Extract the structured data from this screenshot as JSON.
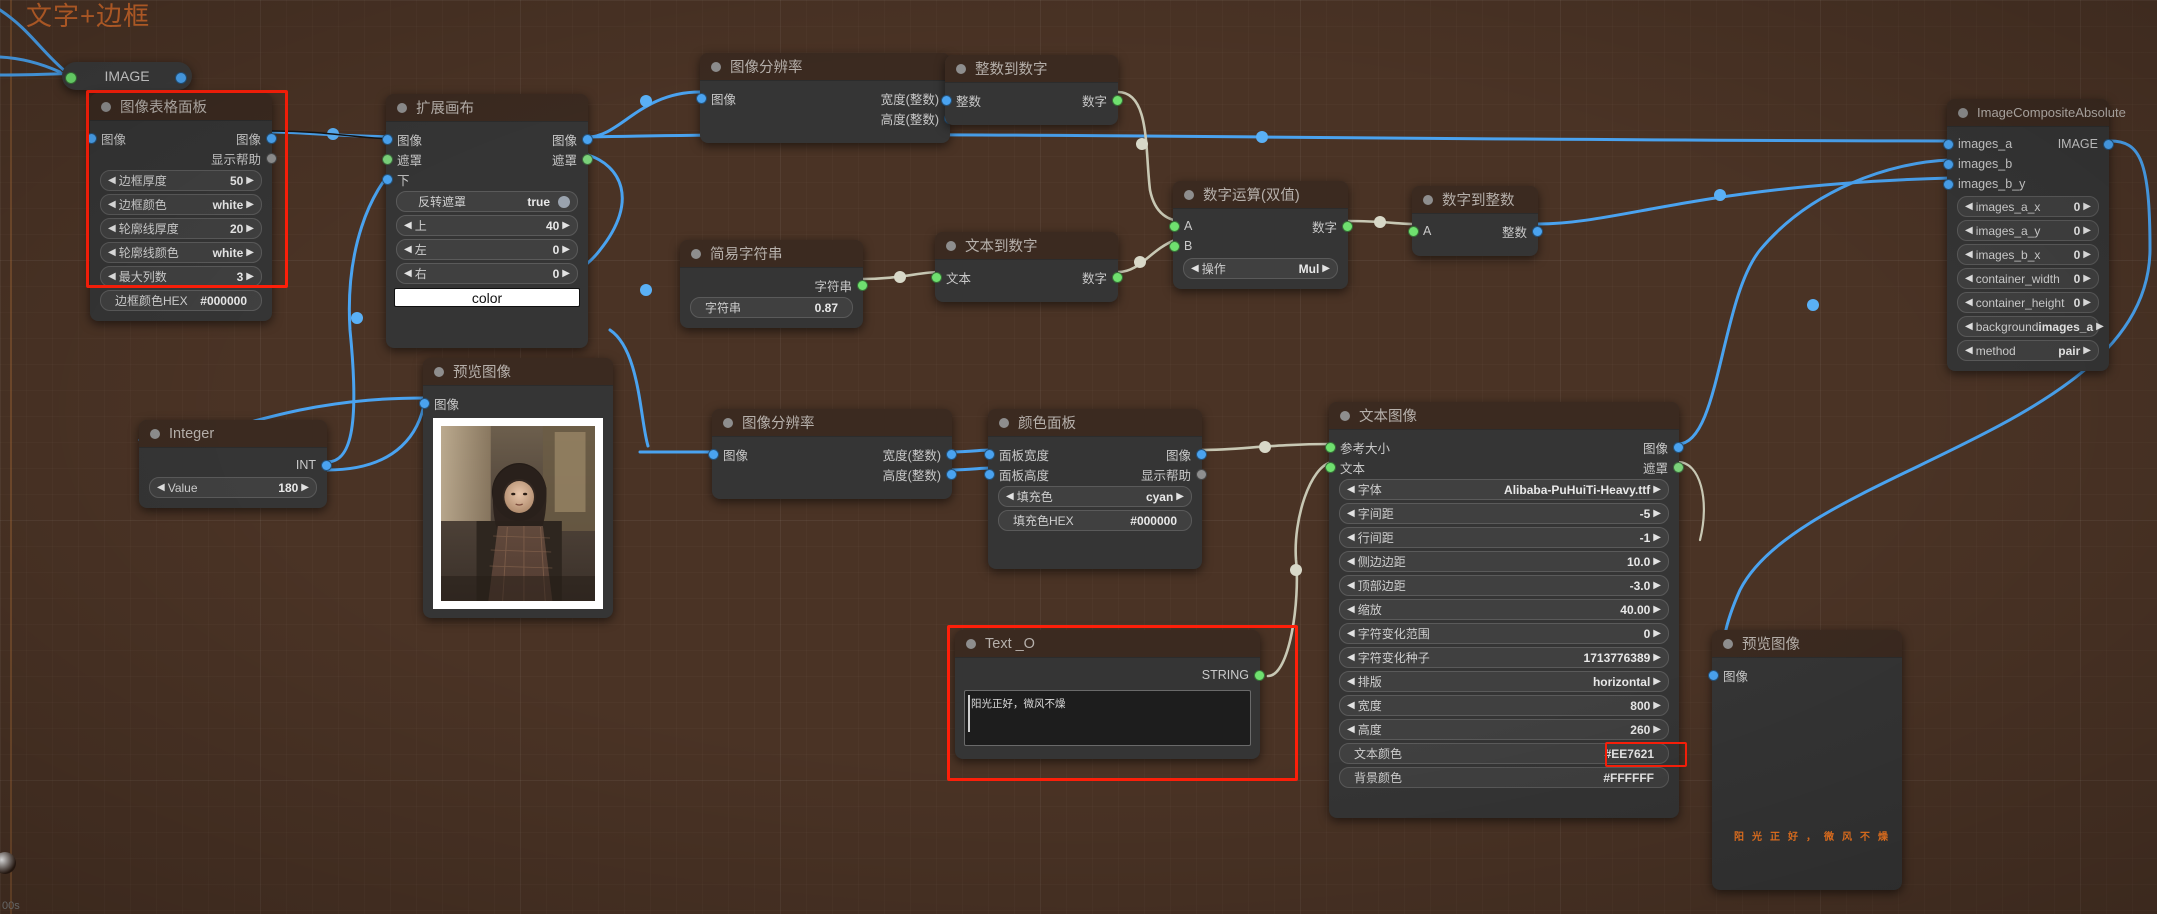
{
  "workspace": {
    "group_title": "文字+边框",
    "status_text": "00s",
    "accent_highlight": "#ff1f09",
    "canvas_bg": "#4a3325",
    "node_bg": "#353535",
    "header_bg": "#3b2a20"
  },
  "reroute": {
    "label": "IMAGE"
  },
  "nodes": {
    "image_grid_panel": {
      "title": "图像表格面板",
      "inputs": [
        {
          "name": "图像",
          "type": "IMAGE"
        }
      ],
      "outputs": [
        {
          "name": "图像",
          "type": "IMAGE"
        },
        {
          "name": "显示帮助",
          "type": "ANY"
        }
      ],
      "widgets": [
        {
          "label": "边框厚度",
          "value": "50"
        },
        {
          "label": "边框颜色",
          "value": "white"
        },
        {
          "label": "轮廓线厚度",
          "value": "20"
        },
        {
          "label": "轮廓线颜色",
          "value": "white"
        },
        {
          "label": "最大列数",
          "value": "3"
        },
        {
          "label": "边框颜色HEX",
          "value": "#000000"
        }
      ]
    },
    "expand_canvas": {
      "title": "扩展画布",
      "inputs": [
        {
          "name": "图像",
          "type": "IMAGE"
        },
        {
          "name": "遮罩",
          "type": "MASK"
        },
        {
          "name": "下",
          "type": "INT"
        }
      ],
      "outputs": [
        {
          "name": "图像",
          "type": "IMAGE"
        },
        {
          "name": "遮罩",
          "type": "MASK"
        }
      ],
      "widgets": [
        {
          "label": "反转遮罩",
          "value": "true",
          "kind": "toggle"
        },
        {
          "label": "上",
          "value": "40"
        },
        {
          "label": "左",
          "value": "0"
        },
        {
          "label": "右",
          "value": "0"
        }
      ],
      "color_bar": "color"
    },
    "image_resolution_top": {
      "title": "图像分辨率",
      "inputs": [
        {
          "name": "图像",
          "type": "IMAGE"
        }
      ],
      "outputs": [
        {
          "name": "宽度(整数)",
          "type": "INT"
        },
        {
          "name": "高度(整数)",
          "type": "INT"
        }
      ]
    },
    "int_to_number": {
      "title": "整数到数字",
      "inputs": [
        {
          "name": "整数",
          "type": "INT"
        }
      ],
      "outputs": [
        {
          "name": "数字",
          "type": "NUMBER"
        }
      ]
    },
    "simple_string": {
      "title": "简易字符串",
      "outputs": [
        {
          "name": "字符串",
          "type": "STRING"
        }
      ],
      "widgets": [
        {
          "label": "字符串",
          "value": "0.87",
          "kind": "plain"
        }
      ]
    },
    "text_to_number": {
      "title": "文本到数字",
      "inputs": [
        {
          "name": "文本",
          "type": "STRING"
        }
      ],
      "outputs": [
        {
          "name": "数字",
          "type": "NUMBER"
        }
      ]
    },
    "number_op_dual": {
      "title": "数字运算(双值)",
      "inputs": [
        {
          "name": "A",
          "type": "NUMBER"
        },
        {
          "name": "B",
          "type": "NUMBER"
        }
      ],
      "outputs": [
        {
          "name": "数字",
          "type": "NUMBER"
        }
      ],
      "widgets": [
        {
          "label": "操作",
          "value": "Mul"
        }
      ]
    },
    "number_to_int": {
      "title": "数字到整数",
      "inputs": [
        {
          "name": "A",
          "type": "NUMBER"
        }
      ],
      "outputs": [
        {
          "name": "整数",
          "type": "INT"
        }
      ]
    },
    "image_composite_absolute": {
      "title": "ImageCompositeAbsolute",
      "inputs": [
        {
          "name": "images_a",
          "type": "IMAGE"
        },
        {
          "name": "images_b",
          "type": "IMAGE"
        },
        {
          "name": "images_b_y",
          "type": "INT"
        }
      ],
      "outputs": [
        {
          "name": "IMAGE",
          "type": "IMAGE"
        }
      ],
      "widgets": [
        {
          "label": "images_a_x",
          "value": "0"
        },
        {
          "label": "images_a_y",
          "value": "0"
        },
        {
          "label": "images_b_x",
          "value": "0"
        },
        {
          "label": "container_width",
          "value": "0"
        },
        {
          "label": "container_height",
          "value": "0"
        },
        {
          "label": "background",
          "value": "images_a"
        },
        {
          "label": "method",
          "value": "pair"
        }
      ]
    },
    "integer": {
      "title": "Integer",
      "outputs": [
        {
          "name": "INT",
          "type": "INT"
        }
      ],
      "widgets": [
        {
          "label": "Value",
          "value": "180"
        }
      ]
    },
    "preview_image_left": {
      "title": "预览图像",
      "inputs": [
        {
          "name": "图像",
          "type": "IMAGE"
        }
      ]
    },
    "image_resolution_mid": {
      "title": "图像分辨率",
      "inputs": [
        {
          "name": "图像",
          "type": "IMAGE"
        }
      ],
      "outputs": [
        {
          "name": "宽度(整数)",
          "type": "INT"
        },
        {
          "name": "高度(整数)",
          "type": "INT"
        }
      ]
    },
    "color_panel": {
      "title": "颜色面板",
      "inputs": [
        {
          "name": "面板宽度",
          "type": "INT"
        },
        {
          "name": "面板高度",
          "type": "INT"
        }
      ],
      "outputs": [
        {
          "name": "图像",
          "type": "IMAGE"
        },
        {
          "name": "显示帮助",
          "type": "ANY"
        }
      ],
      "widgets": [
        {
          "label": "填充色",
          "value": "cyan"
        },
        {
          "label": "填充色HEX",
          "value": "#000000",
          "kind": "plain"
        }
      ]
    },
    "text_o": {
      "title": "Text _O",
      "outputs": [
        {
          "name": "STRING",
          "type": "STRING"
        }
      ],
      "text_value": "阳光正好，微风不燥"
    },
    "text_image": {
      "title": "文本图像",
      "inputs": [
        {
          "name": "参考大小",
          "type": "IMAGE"
        },
        {
          "name": "文本",
          "type": "STRING"
        }
      ],
      "outputs": [
        {
          "name": "图像",
          "type": "IMAGE"
        },
        {
          "name": "遮罩",
          "type": "MASK"
        }
      ],
      "widgets": [
        {
          "label": "字体",
          "value": "Alibaba-PuHuiTi-Heavy.ttf"
        },
        {
          "label": "字间距",
          "value": "-5"
        },
        {
          "label": "行间距",
          "value": "-1"
        },
        {
          "label": "侧边边距",
          "value": "10.0"
        },
        {
          "label": "顶部边距",
          "value": "-3.0"
        },
        {
          "label": "缩放",
          "value": "40.00"
        },
        {
          "label": "字符变化范围",
          "value": "0"
        },
        {
          "label": "字符变化种子",
          "value": "1713776389"
        },
        {
          "label": "排版",
          "value": "horizontal"
        },
        {
          "label": "宽度",
          "value": "800"
        },
        {
          "label": "高度",
          "value": "260"
        },
        {
          "label": "文本颜色",
          "value": "#EE7621",
          "kind": "plain",
          "highlighted": true
        },
        {
          "label": "背景颜色",
          "value": "#FFFFFF",
          "kind": "plain"
        }
      ]
    },
    "preview_image_right": {
      "title": "预览图像",
      "inputs": [
        {
          "name": "图像",
          "type": "IMAGE"
        }
      ],
      "preview_text": "阳光正好，微风不燥"
    }
  }
}
